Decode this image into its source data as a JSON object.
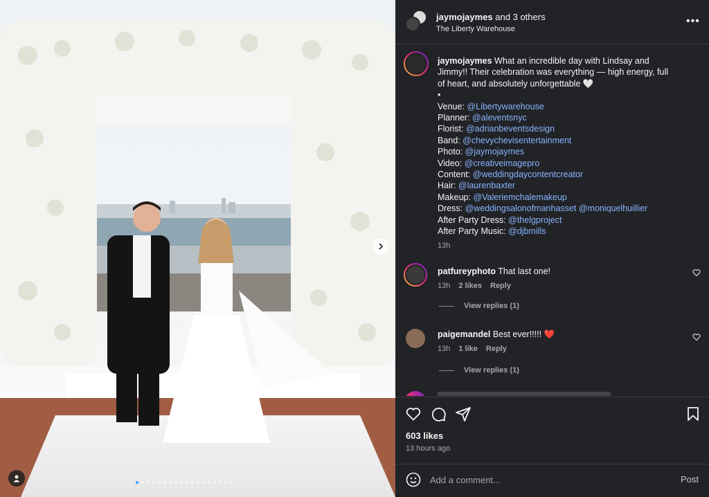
{
  "header": {
    "username": "jaymojaymes",
    "and_others": "and 3 others",
    "location": "The Liberty Warehouse",
    "more_label": "•••"
  },
  "caption": {
    "username": "jaymojaymes",
    "text_line1": "What an incredible day with Lindsay and",
    "text_line2": "Jimmy!! Their celebration was everything — high energy, full",
    "text_line3": "of heart, and absolutely unforgettable 🤍",
    "bullet": "•",
    "credits": [
      {
        "label": "Venue:",
        "mentions": "@Libertywarehouse"
      },
      {
        "label": "Planner:",
        "mentions": "@aleventsnyc"
      },
      {
        "label": "Florist:",
        "mentions": "@adrianbeventsdesign"
      },
      {
        "label": "Band:",
        "mentions": "@chevychevisentertainment"
      },
      {
        "label": "Photo:",
        "mentions": "@jaymojaymes"
      },
      {
        "label": "Video:",
        "mentions": "@creativeimagepro"
      },
      {
        "label": "Content:",
        "mentions": "@weddingdaycontentcreator"
      },
      {
        "label": "Hair:",
        "mentions": "@laurenbaxter"
      },
      {
        "label": "Makeup:",
        "mentions": "@Valeriemchalemakeup"
      },
      {
        "label": "Dress:",
        "mentions": "@weddingsalonofmanhasset @moniquelhuillier"
      },
      {
        "label": "After Party Dress:",
        "mentions": "@thelgproject"
      },
      {
        "label": "After Party Music:",
        "mentions": "@djbmills"
      }
    ],
    "time": "13h"
  },
  "comments": [
    {
      "username": "patfureyphoto",
      "text": "That last one!",
      "time": "13h",
      "likes": "2 likes",
      "reply": "Reply",
      "view_replies": "View replies (1)"
    },
    {
      "username": "paigemandel",
      "text": "Best ever!!!!! ❤️",
      "time": "13h",
      "likes": "1 like",
      "reply": "Reply",
      "view_replies": "View replies (1)"
    }
  ],
  "post_stats": {
    "likes": "603 likes",
    "time_ago": "13 hours ago"
  },
  "composer": {
    "placeholder": "Add a comment...",
    "post_label": "Post"
  },
  "carousel": {
    "slide_count": 18,
    "active_index": 0
  },
  "colors": {
    "panel_bg": "#212327",
    "mention": "#8ab4ff",
    "story_ring": [
      "#f9ce34",
      "#ee2a7b",
      "#6228d7"
    ]
  }
}
